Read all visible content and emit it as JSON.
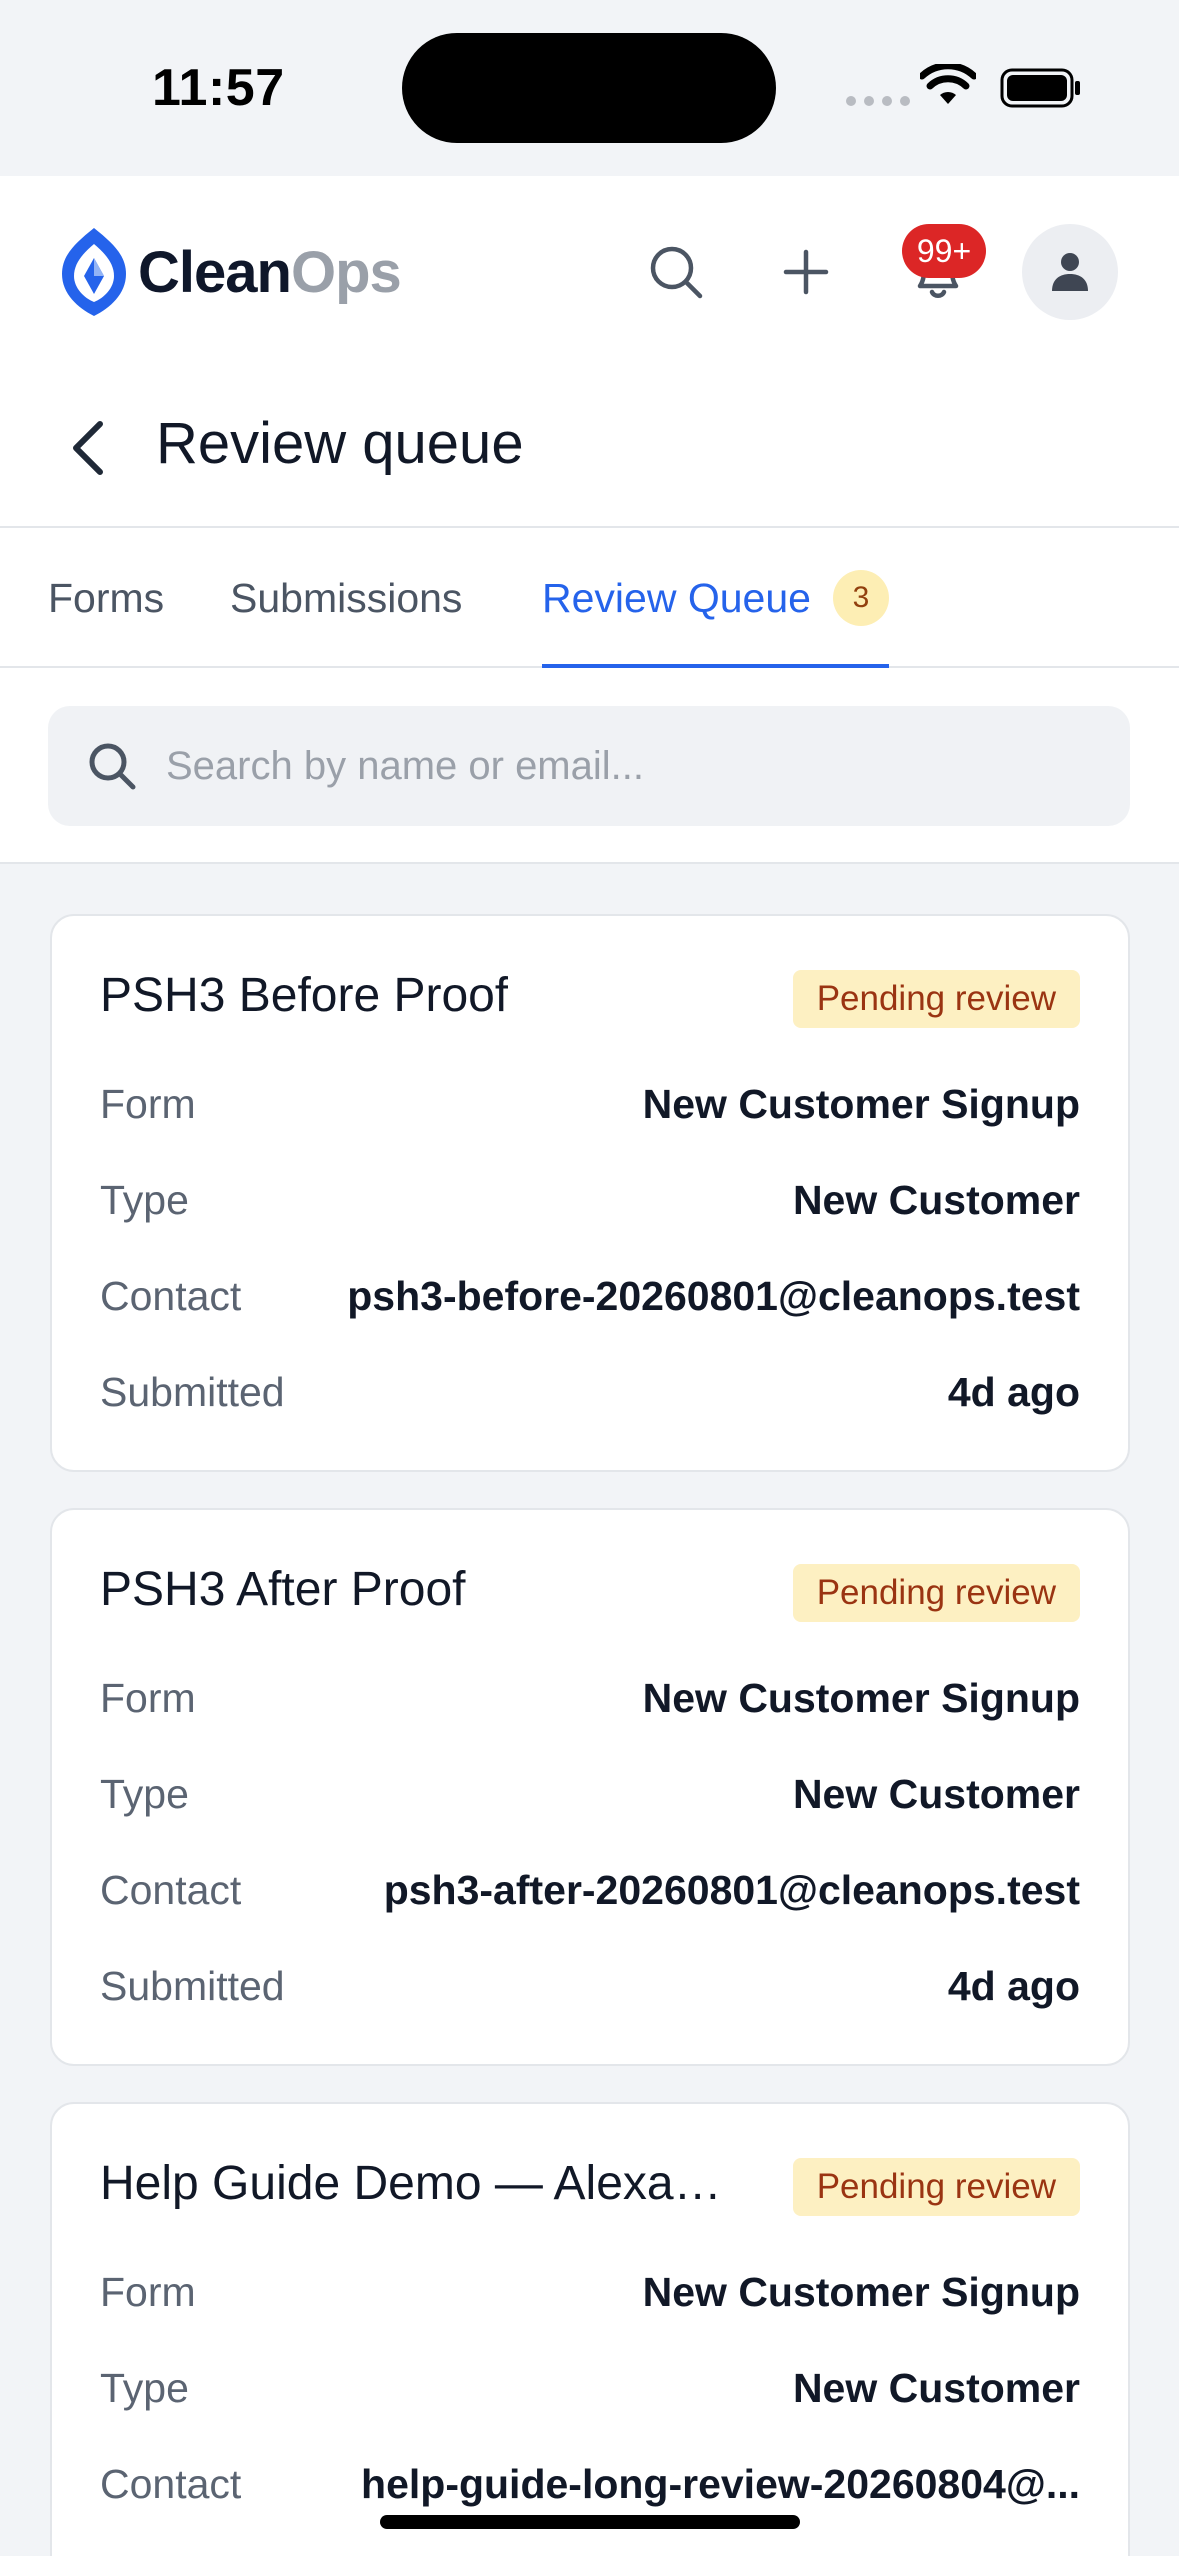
{
  "status_bar": {
    "time": "11:57"
  },
  "header": {
    "logo_clean": "Clean",
    "logo_ops": "Ops",
    "notification_count": "99+",
    "icons": [
      "logo-icon",
      "search-icon",
      "plus-icon",
      "bell-icon",
      "user-icon"
    ]
  },
  "page": {
    "title": "Review queue"
  },
  "tabs": [
    {
      "label": "Forms",
      "active": false
    },
    {
      "label": "Submissions",
      "active": false
    },
    {
      "label": "Review Queue",
      "active": true,
      "count": "3"
    }
  ],
  "search": {
    "placeholder": "Search by name or email..."
  },
  "colors": {
    "accent": "#2563eb",
    "badge_bg": "#fdf0c2",
    "badge_text": "#9a3412",
    "notification": "#dc2626"
  },
  "cards": [
    {
      "title": "PSH3 Before Proof",
      "status": "Pending review",
      "rows": [
        {
          "label": "Form",
          "value": "New Customer Signup"
        },
        {
          "label": "Type",
          "value": "New Customer"
        },
        {
          "label": "Contact",
          "value": "psh3-before-20260801@cleanops.test"
        },
        {
          "label": "Submitted",
          "value": "4d ago"
        }
      ]
    },
    {
      "title": "PSH3 After Proof",
      "status": "Pending review",
      "rows": [
        {
          "label": "Form",
          "value": "New Customer Signup"
        },
        {
          "label": "Type",
          "value": "New Customer"
        },
        {
          "label": "Contact",
          "value": "psh3-after-20260801@cleanops.test"
        },
        {
          "label": "Submitted",
          "value": "4d ago"
        }
      ]
    },
    {
      "title": "Help Guide Demo — Alexan...",
      "status": "Pending review",
      "rows": [
        {
          "label": "Form",
          "value": "New Customer Signup"
        },
        {
          "label": "Type",
          "value": "New Customer"
        },
        {
          "label": "Contact",
          "value": "help-guide-long-review-20260804@..."
        }
      ]
    }
  ]
}
